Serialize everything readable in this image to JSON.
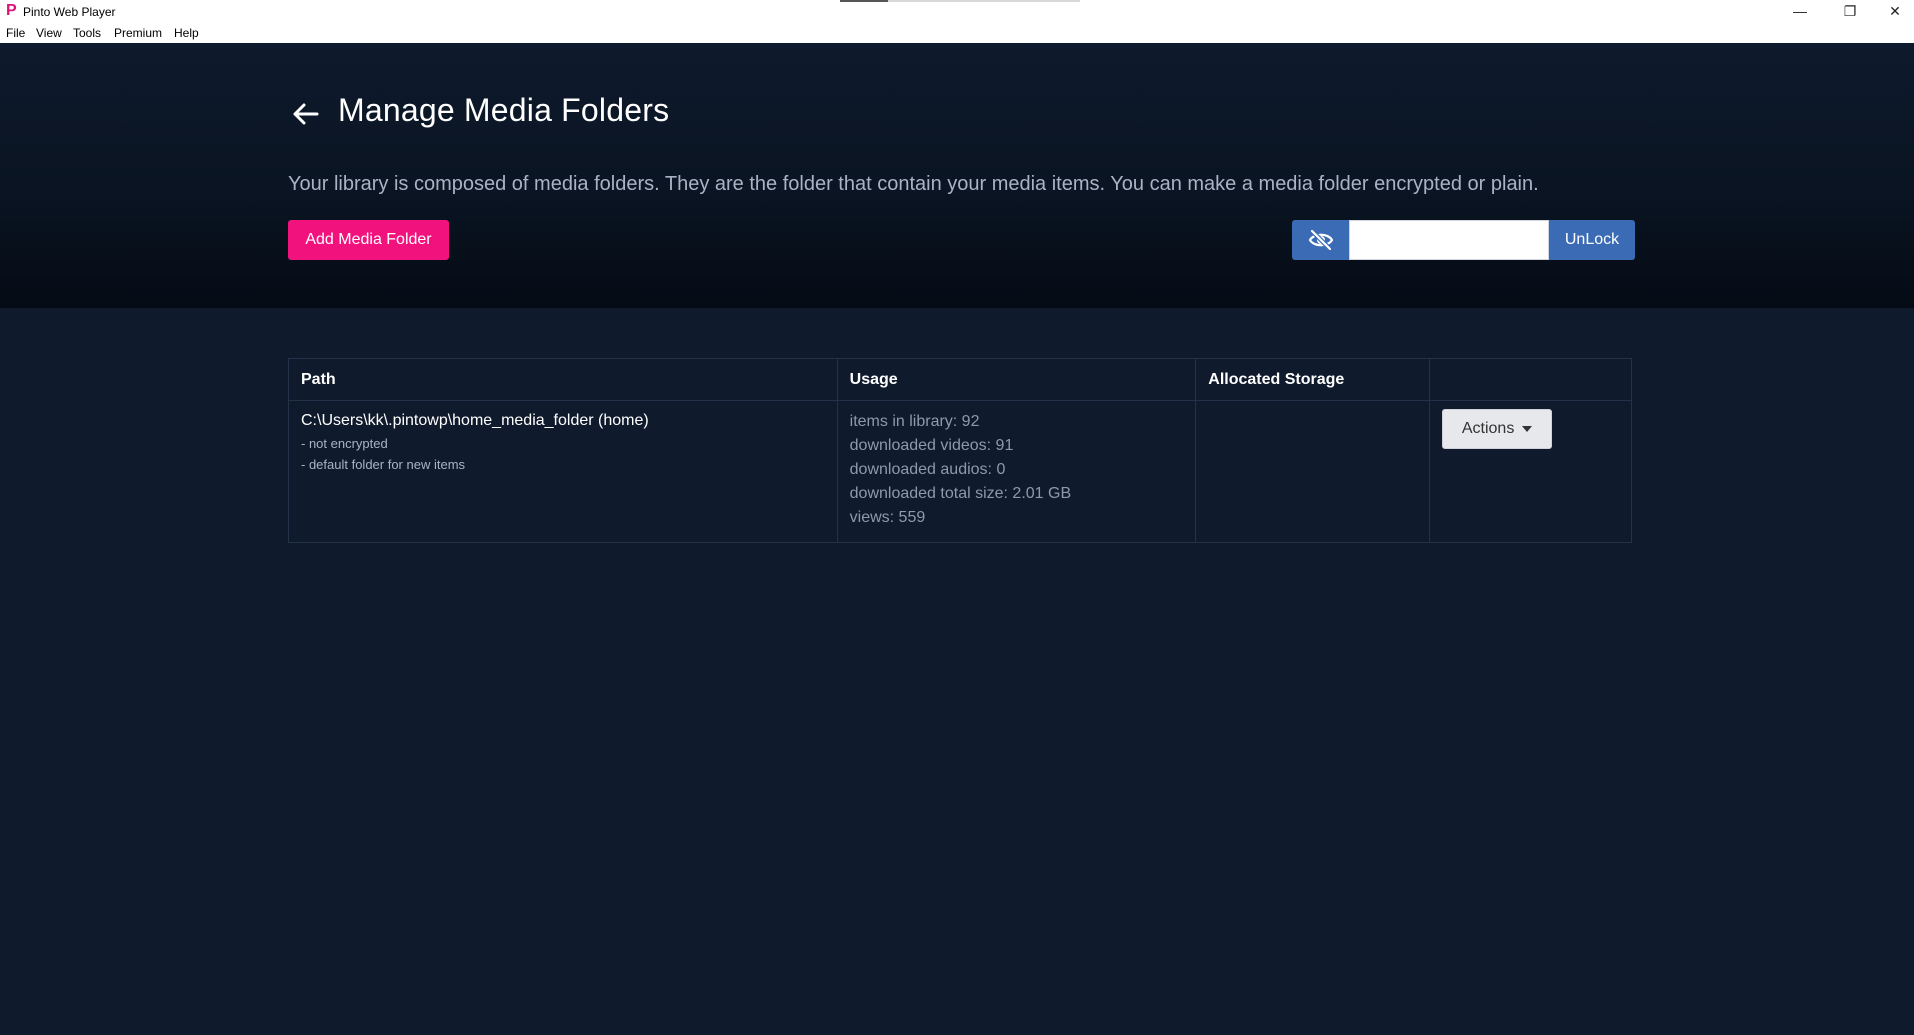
{
  "window": {
    "app_title": "Pinto Web Player",
    "logo_letter": "P",
    "minimize_glyph": "—",
    "maximize_glyph": "❐",
    "close_glyph": "✕"
  },
  "menu": {
    "items": [
      "File",
      "View",
      "Tools",
      "Premium",
      "Help"
    ]
  },
  "page": {
    "title": "Manage Media Folders",
    "description": "Your library is composed of media folders. They are the folder that contain your media items. You can make a media folder encrypted or plain.",
    "add_button_label": "Add Media Folder",
    "password": {
      "toggle_icon": "eye-slash-icon",
      "value": "",
      "placeholder": ""
    },
    "unlock_button_label": "UnLock"
  },
  "table": {
    "headers": [
      "Path",
      "Usage",
      "Allocated Storage",
      ""
    ],
    "rows": [
      {
        "path": "C:\\Users\\kk\\.pintowp\\home_media_folder (home)",
        "notes": [
          "- not encrypted",
          "- default folder for new items"
        ],
        "usage": [
          "items in library: 92",
          "downloaded videos: 91",
          "downloaded audios: 0",
          "downloaded total size: 2.01 GB",
          "views: 559"
        ],
        "allocated_storage": "",
        "actions_label": "Actions"
      }
    ]
  },
  "colors": {
    "accent_pink": "#f2127e",
    "primary_blue": "#3b6bb5",
    "background": "#0f1a2c"
  }
}
